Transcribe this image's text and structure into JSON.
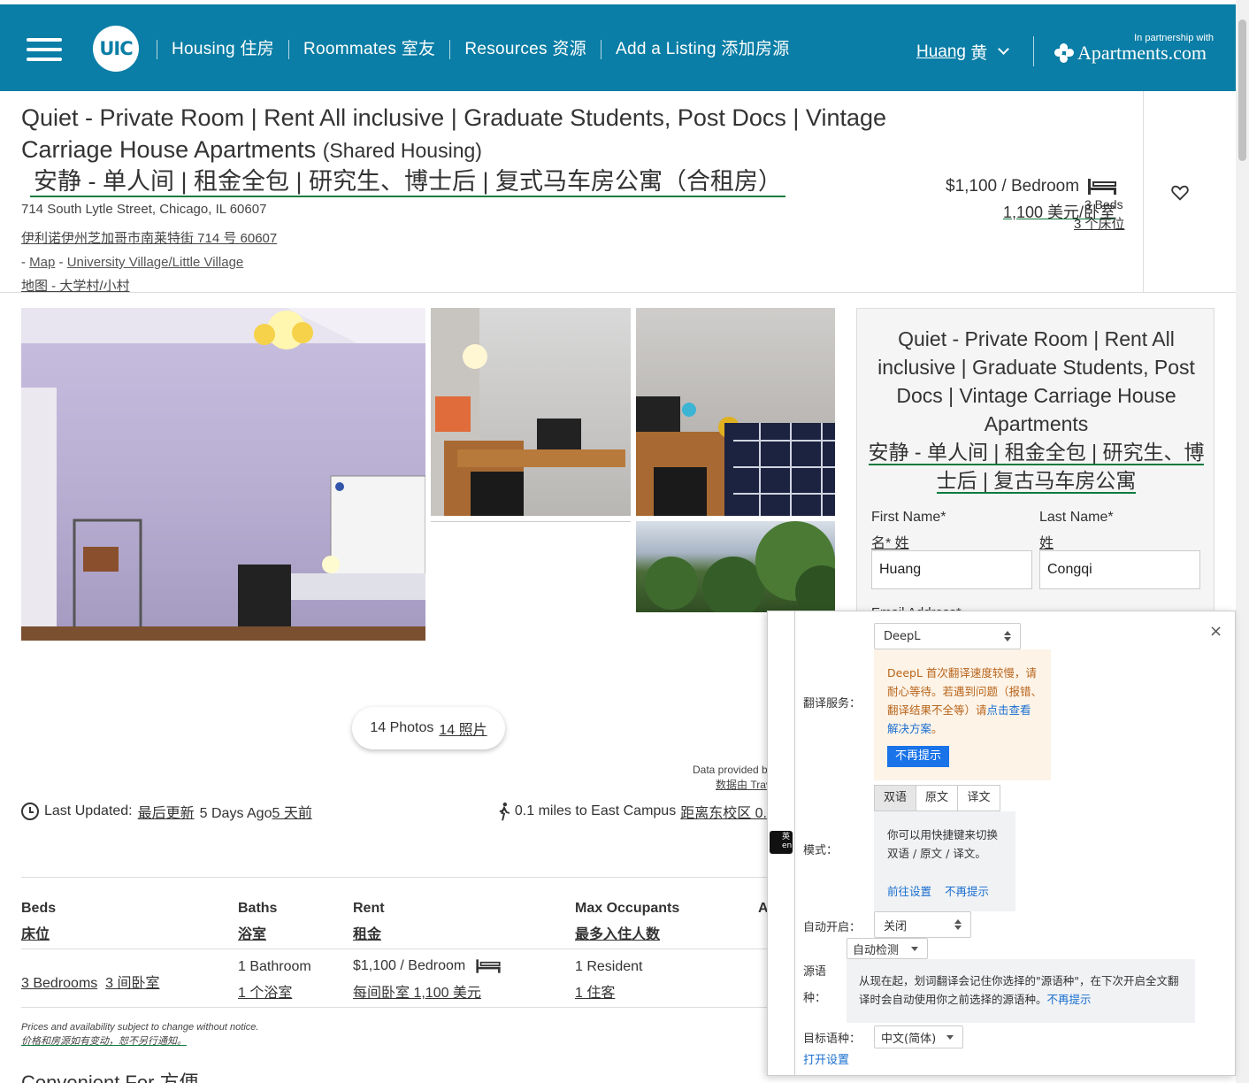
{
  "header": {
    "logo": "UIC",
    "nav": [
      "Housing 住房",
      "Roommates 室友",
      "Resources 资源",
      "Add a Listing 添加房源"
    ],
    "user_name": "Huang",
    "user_name_zh": "黄",
    "partner_label": "In partnership with",
    "partner_brand": "Apartments.com"
  },
  "listing": {
    "title_en": "Quiet - Private Room | Rent All inclusive | Graduate Students, Post Docs | Vintage Carriage House Apartments",
    "title_suffix": "(Shared Housing)",
    "title_zh": "安静 - 单人间 | 租金全包 | 研究生、博士后 | 复式马车房公寓（合租房）",
    "address_en": "714 South Lytle Street, Chicago, IL 60607",
    "address_zh": "伊利诺伊州芝加哥市南莱特街 714 号 60607",
    "map_prefix": "- ",
    "map_label": "Map",
    "map_sep": " - ",
    "neighborhood": "University Village/Little Village",
    "map_zh": "地图 - 大学村/小村",
    "price_en": "$1,100 / Bedroom",
    "price_zh": "1,100 美元/卧室",
    "beds_en": "3 Beds",
    "beds_zh": "3 个床位"
  },
  "photos": {
    "button_en": "14 Photos",
    "button_zh": "14 照片",
    "data_provided_en": "Data provided b",
    "data_provided_zh": "数据由 Trav"
  },
  "meta": {
    "updated_label": "Last Updated:",
    "updated_label_zh": "最后更新",
    "updated_value": "5 Days Ago",
    "updated_value_zh": "5 天前",
    "distance_en": "0.1 miles to East Campus",
    "distance_zh": "距离东校区 0."
  },
  "details": {
    "headers": [
      {
        "en": "Beds",
        "zh": "床位"
      },
      {
        "en": "Baths",
        "zh": "浴室"
      },
      {
        "en": "Rent",
        "zh": "租金"
      },
      {
        "en": "Max Occupants",
        "zh": "最多入住人数"
      },
      {
        "en": "A",
        "zh": ""
      }
    ],
    "beds_value": "3 Bedrooms",
    "beds_value_zh": "3 间卧室",
    "baths_value": "1 Bathroom",
    "baths_value_zh": "1 个浴室",
    "rent_value": "$1,100 / Bedroom",
    "rent_value_zh": "每间卧室 1,100 美元",
    "occupants_value": "1 Resident",
    "occupants_value_zh": "1 住客",
    "disclaimer_en": "Prices and availability subject to change without notice.",
    "disclaimer_zh": "价格和房源如有变动，恕不另行通知。",
    "convenient_for": "Convenient For",
    "convenient_for_zh": "方便"
  },
  "contact_card": {
    "title_en": "Quiet - Private Room | Rent All inclusive | Graduate Students, Post Docs | Vintage Carriage House Apartments",
    "title_zh": "安静 - 单人间 | 租金全包 | 研究生、博士后 | 复古马车房公寓",
    "first_name_label": "First Name*",
    "first_name_label_zh": "名* 姓",
    "last_name_label": "Last Name*",
    "last_name_label_zh": "姓",
    "first_name_value": "Huang",
    "last_name_value": "Congqi",
    "email_label": "Email Address*"
  },
  "translator": {
    "close": "×",
    "toggle_text": "英 en",
    "service_label": "翻译服务：",
    "service_value": "DeepL",
    "warning_text": "DeepL 首次翻译速度较慢，请耐心等待。若遇到问题（报错、翻译结果不全等）请",
    "warning_link": "点击查看解决方案",
    "warning_end": "。",
    "dismiss_button": "不再提示",
    "mode_label": "模式：",
    "modes": [
      "双语",
      "原文",
      "译文"
    ],
    "mode_hint": "你可以用快捷键来切换双语 / 原文 / 译文。",
    "goto_settings": "前往设置",
    "no_more_hint": "不再提示",
    "auto_label": "自动开启：",
    "auto_value": "关闭",
    "source_label": "源语种：",
    "source_value": "自动检测",
    "source_hint": "从现在起，划词翻译会记住你选择的\"源语种\"，在下次开启全文翻译时会自动使用你之前选择的源语种。",
    "source_hint_link": "不再提示",
    "target_label": "目标语种：",
    "target_value": "中文(简体)",
    "open_settings": "打开设置"
  },
  "colors": {
    "header_bg": "#0a7ea6",
    "translation_underline": "#0d7a3e",
    "link_blue": "#1a6fd0",
    "warning_bg": "#fdf3e7",
    "warning_text": "#b8651b"
  }
}
